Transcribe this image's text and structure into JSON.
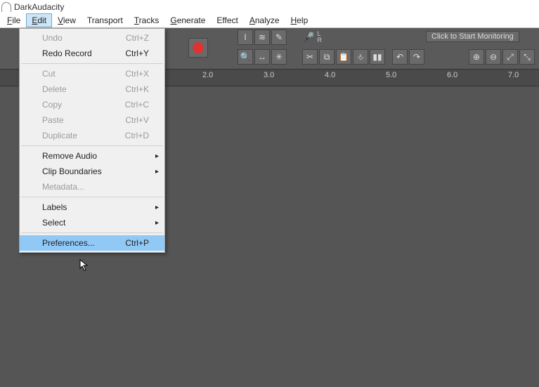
{
  "app": {
    "title": "DarkAudacity"
  },
  "menubar": {
    "file": "File",
    "edit": "Edit",
    "view": "View",
    "transport": "Transport",
    "tracks": "Tracks",
    "generate": "Generate",
    "effect": "Effect",
    "analyze": "Analyze",
    "help": "Help"
  },
  "edit_menu": {
    "undo": "Undo",
    "undo_sc": "Ctrl+Z",
    "redo": "Redo Record",
    "redo_sc": "Ctrl+Y",
    "cut": "Cut",
    "cut_sc": "Ctrl+X",
    "delete": "Delete",
    "delete_sc": "Ctrl+K",
    "copy": "Copy",
    "copy_sc": "Ctrl+C",
    "paste": "Paste",
    "paste_sc": "Ctrl+V",
    "duplicate": "Duplicate",
    "duplicate_sc": "Ctrl+D",
    "remove_audio": "Remove Audio",
    "clip_boundaries": "Clip Boundaries",
    "metadata": "Metadata...",
    "labels": "Labels",
    "select": "Select",
    "preferences": "Preferences...",
    "preferences_sc": "Ctrl+P"
  },
  "toolbar": {
    "monitor": "Click to Start Monitoring",
    "L": "L",
    "R": "R"
  },
  "timeline": {
    "t1": "2.0",
    "t2": "3.0",
    "t3": "4.0",
    "t4": "5.0",
    "t5": "6.0",
    "t6": "7.0"
  },
  "icons": {
    "cursor_i": "I",
    "envelope": "≋",
    "draw": "✎",
    "zoom": "🔍",
    "timeshift": "↔",
    "multi": "✳",
    "cut": "✂",
    "copy": "⧉",
    "paste": "📋",
    "trim": "⎀",
    "sil": "▮▮",
    "undo": "↶",
    "redo": "↷",
    "zin": "⊕",
    "zout": "⊖",
    "zfit": "⤢",
    "zsel": "⤡",
    "mic": "🎤",
    "arrow_sub": "▸"
  }
}
